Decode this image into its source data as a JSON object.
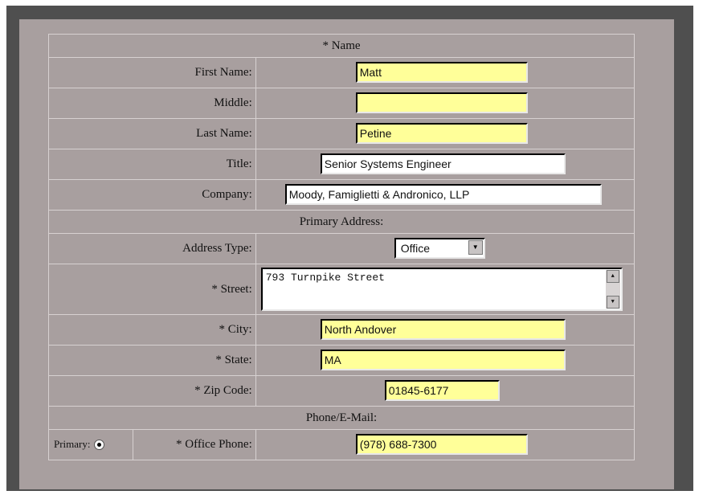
{
  "form": {
    "name_header": "* Name",
    "first_name": {
      "label": "First Name:",
      "value": "Matt"
    },
    "middle": {
      "label": "Middle:",
      "value": ""
    },
    "last_name": {
      "label": "Last Name:",
      "value": "Petine"
    },
    "title": {
      "label": "Title:",
      "value": "Senior Systems Engineer"
    },
    "company": {
      "label": "Company:",
      "value": "Moody, Famiglietti & Andronico, LLP"
    },
    "address_header": "Primary Address:",
    "address_type": {
      "label": "Address Type:",
      "value": "Office"
    },
    "street": {
      "label": "* Street:",
      "value": "793 Turnpike Street"
    },
    "city": {
      "label": "* City:",
      "value": "North Andover"
    },
    "state": {
      "label": "* State:",
      "value": "MA"
    },
    "zip": {
      "label": "* Zip Code:",
      "value": "01845-6177"
    },
    "phone_header": "Phone/E-Mail:",
    "office_phone": {
      "primary_label": "Primary:",
      "label": "* Office Phone:",
      "value": "(978) 688-7300"
    }
  },
  "colors": {
    "required_field": "#ffff99",
    "page_bg": "#a89f9f",
    "frame": "#4f4f4f"
  }
}
